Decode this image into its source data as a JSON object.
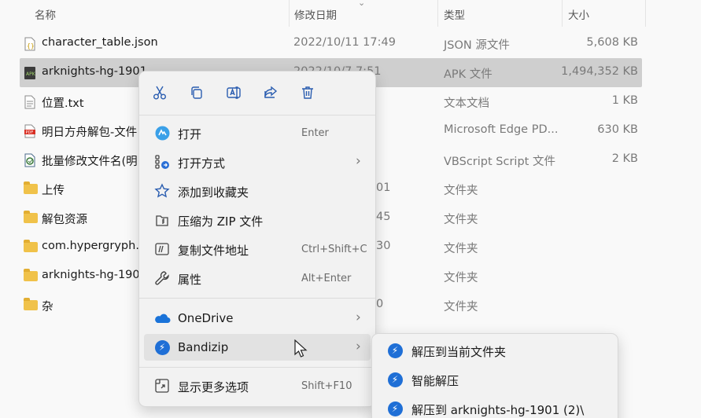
{
  "columns": {
    "name": "名称",
    "modified": "修改日期",
    "type": "类型",
    "size": "大小"
  },
  "files": [
    {
      "name": "character_table.json",
      "date": "2022/10/11 17:49",
      "type": "JSON 源文件",
      "size": "5,608 KB",
      "icon": "json-file-icon"
    },
    {
      "name": "arknights-hg-1901",
      "date": "2022/10/7 7:51",
      "type": "APK 文件",
      "size": "1,494,352 KB",
      "icon": "apk-file-icon",
      "selected": true
    },
    {
      "name": "位置.txt",
      "date": "",
      "type": "文本文档",
      "size": "1 KB",
      "icon": "text-file-icon"
    },
    {
      "name": "明日方舟解包-文件",
      "date": "",
      "type": "Microsoft Edge PD...",
      "size": "630 KB",
      "icon": "pdf-file-icon"
    },
    {
      "name": "批量修改文件名(明日",
      "date": "",
      "type": "VBScript Script 文件",
      "size": "2 KB",
      "icon": "script-file-icon"
    },
    {
      "name": "上传",
      "date": "01",
      "type": "文件夹",
      "size": "",
      "icon": "folder-icon"
    },
    {
      "name": "解包资源",
      "date": "45",
      "type": "文件夹",
      "size": "",
      "icon": "folder-icon"
    },
    {
      "name": "com.hypergryph.a",
      "date": "30",
      "type": "文件夹",
      "size": "",
      "icon": "folder-icon"
    },
    {
      "name": "arknights-hg-190",
      "date": "",
      "type": "文件夹",
      "size": "",
      "icon": "folder-icon"
    },
    {
      "name": "杂",
      "date": "0",
      "type": "文件夹",
      "size": "",
      "icon": "folder-icon"
    }
  ],
  "context_menu": {
    "toolbar": [
      "cut-icon",
      "copy-icon",
      "rename-icon",
      "share-icon",
      "delete-icon"
    ],
    "items": [
      {
        "label": "打开",
        "shortcut": "Enter",
        "icon": "app-icon"
      },
      {
        "label": "打开方式",
        "shortcut": "",
        "icon": "open-with-icon",
        "submenu": true
      },
      {
        "label": "添加到收藏夹",
        "shortcut": "",
        "icon": "star-icon"
      },
      {
        "label": "压缩为 ZIP 文件",
        "shortcut": "",
        "icon": "zip-icon"
      },
      {
        "label": "复制文件地址",
        "shortcut": "Ctrl+Shift+C",
        "icon": "copy-path-icon"
      },
      {
        "label": "属性",
        "shortcut": "Alt+Enter",
        "icon": "wrench-icon"
      }
    ],
    "extensions": [
      {
        "label": "OneDrive",
        "icon": "onedrive-icon",
        "submenu": true
      },
      {
        "label": "Bandizip",
        "icon": "bandizip-icon",
        "submenu": true
      }
    ],
    "more": {
      "label": "显示更多选项",
      "shortcut": "Shift+F10",
      "icon": "more-options-icon"
    }
  },
  "bandizip_submenu": [
    {
      "label": "解压到当前文件夹"
    },
    {
      "label": "智能解压"
    },
    {
      "label": "解压到 arknights-hg-1901 (2)\\"
    }
  ],
  "colors": {
    "selection": "#cfcfcf",
    "menu_bg": "#f2f2f2",
    "accent": "#1f6fd6",
    "folder": "#f0c24a"
  }
}
